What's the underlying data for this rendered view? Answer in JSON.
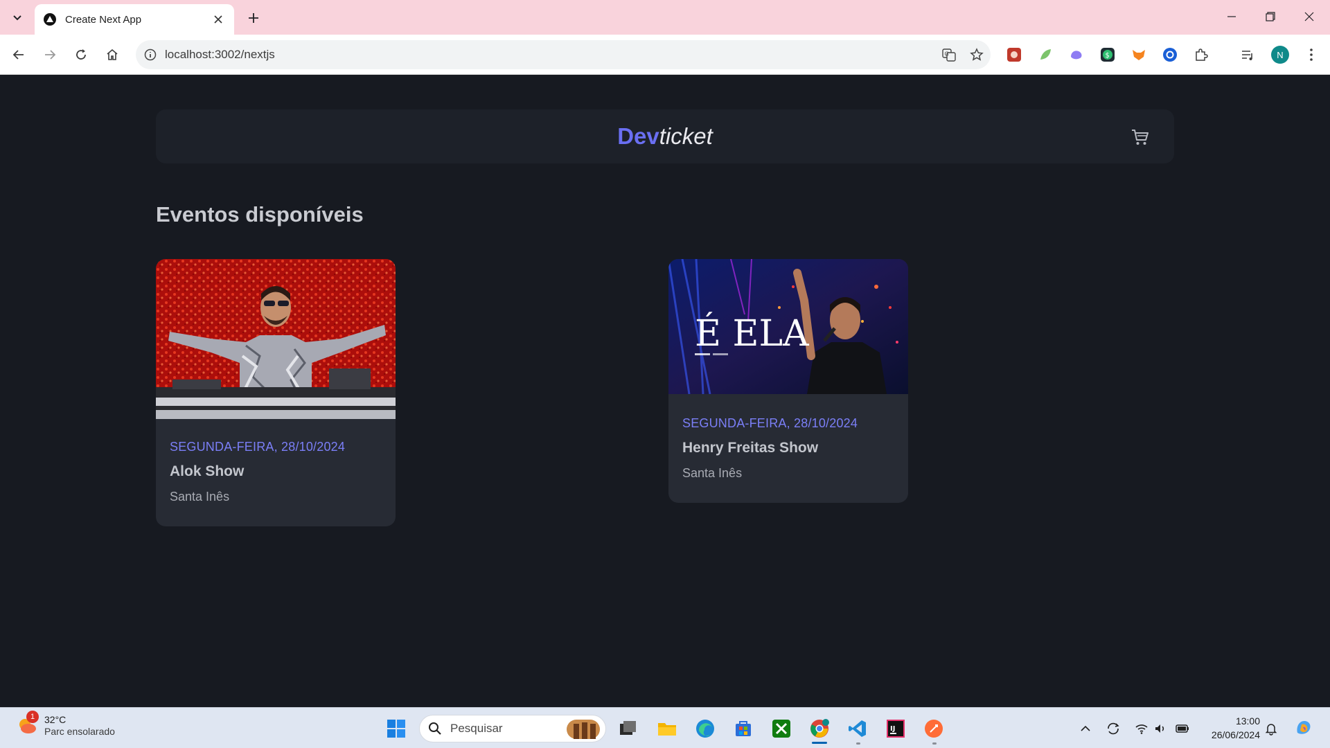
{
  "browser": {
    "tab_title": "Create Next App",
    "url": "localhost:3002/nextjs",
    "profile_initial": "N"
  },
  "site": {
    "logo_dev": "Dev",
    "logo_ticket": "ticket",
    "section_title": "Eventos disponíveis",
    "accent_color": "#6a6ff2"
  },
  "events": [
    {
      "date": "SEGUNDA-FEIRA, 28/10/2024",
      "name": "Alok Show",
      "location": "Santa Inês"
    },
    {
      "date": "SEGUNDA-FEIRA, 28/10/2024",
      "name": "Henry Freitas Show",
      "location": "Santa Inês",
      "image_text": "É ELA"
    }
  ],
  "taskbar": {
    "weather_temp": "32°C",
    "weather_desc": "Parc ensolarado",
    "weather_badge": "1",
    "search_placeholder": "Pesquisar",
    "time": "13:00",
    "date": "26/06/2024"
  }
}
